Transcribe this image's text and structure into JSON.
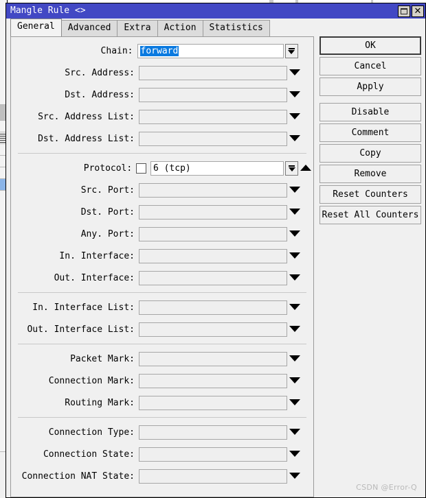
{
  "window": {
    "title": "Mangle Rule <>",
    "titlebar_color": "#4248c4",
    "maximize_icon": "maximize-icon",
    "close_icon": "close-icon"
  },
  "tabs": [
    {
      "label": "General",
      "active": true
    },
    {
      "label": "Advanced",
      "active": false
    },
    {
      "label": "Extra",
      "active": false
    },
    {
      "label": "Action",
      "active": false
    },
    {
      "label": "Statistics",
      "active": false
    }
  ],
  "form": {
    "groups": [
      {
        "name": "address-group",
        "rows": [
          {
            "label": "Chain:",
            "value": "forward",
            "value_selected": true,
            "white": true,
            "has_dropbutton": true,
            "has_caret": false,
            "has_checkbox": false
          },
          {
            "label": "Src. Address:",
            "value": "",
            "has_caret": true,
            "caret": "down"
          },
          {
            "label": "Dst. Address:",
            "value": "",
            "has_caret": true,
            "caret": "down"
          },
          {
            "label": "Src. Address List:",
            "value": "",
            "has_caret": true,
            "caret": "down"
          },
          {
            "label": "Dst. Address List:",
            "value": "",
            "has_caret": true,
            "caret": "down"
          }
        ]
      },
      {
        "name": "protocol-group",
        "rows": [
          {
            "label": "Protocol:",
            "value": "6 (tcp)",
            "white": true,
            "has_checkbox": true,
            "checked": false,
            "has_dropbutton": true,
            "has_caret": true,
            "caret": "up"
          },
          {
            "label": "Src. Port:",
            "value": "",
            "has_caret": true,
            "caret": "down"
          },
          {
            "label": "Dst. Port:",
            "value": "",
            "has_caret": true,
            "caret": "down"
          },
          {
            "label": "Any. Port:",
            "value": "",
            "has_caret": true,
            "caret": "down"
          },
          {
            "label": "In. Interface:",
            "value": "",
            "has_caret": true,
            "caret": "down"
          },
          {
            "label": "Out. Interface:",
            "value": "",
            "has_caret": true,
            "caret": "down"
          }
        ]
      },
      {
        "name": "interface-list-group",
        "rows": [
          {
            "label": "In. Interface List:",
            "value": "",
            "has_caret": true,
            "caret": "down"
          },
          {
            "label": "Out. Interface List:",
            "value": "",
            "has_caret": true,
            "caret": "down"
          }
        ]
      },
      {
        "name": "mark-group",
        "rows": [
          {
            "label": "Packet Mark:",
            "value": "",
            "has_caret": true,
            "caret": "down"
          },
          {
            "label": "Connection Mark:",
            "value": "",
            "has_caret": true,
            "caret": "down"
          },
          {
            "label": "Routing Mark:",
            "value": "",
            "has_caret": true,
            "caret": "down"
          }
        ]
      },
      {
        "name": "connection-group",
        "rows": [
          {
            "label": "Connection Type:",
            "value": "",
            "has_caret": true,
            "caret": "down"
          },
          {
            "label": "Connection State:",
            "value": "",
            "has_caret": true,
            "caret": "down"
          },
          {
            "label": "Connection NAT State:",
            "value": "",
            "has_caret": true,
            "caret": "down"
          }
        ]
      }
    ]
  },
  "buttons": [
    {
      "label": "OK",
      "primary": true,
      "gap_after": false
    },
    {
      "label": "Cancel",
      "primary": false,
      "gap_after": false
    },
    {
      "label": "Apply",
      "primary": false,
      "gap_after": true
    },
    {
      "label": "Disable",
      "primary": false,
      "gap_after": false
    },
    {
      "label": "Comment",
      "primary": false,
      "gap_after": false
    },
    {
      "label": "Copy",
      "primary": false,
      "gap_after": false
    },
    {
      "label": "Remove",
      "primary": false,
      "gap_after": false
    },
    {
      "label": "Reset Counters",
      "primary": false,
      "gap_after": false
    },
    {
      "label": "Reset All Counters",
      "primary": false,
      "gap_after": false
    }
  ],
  "watermark": "CSDN @Error-Q"
}
